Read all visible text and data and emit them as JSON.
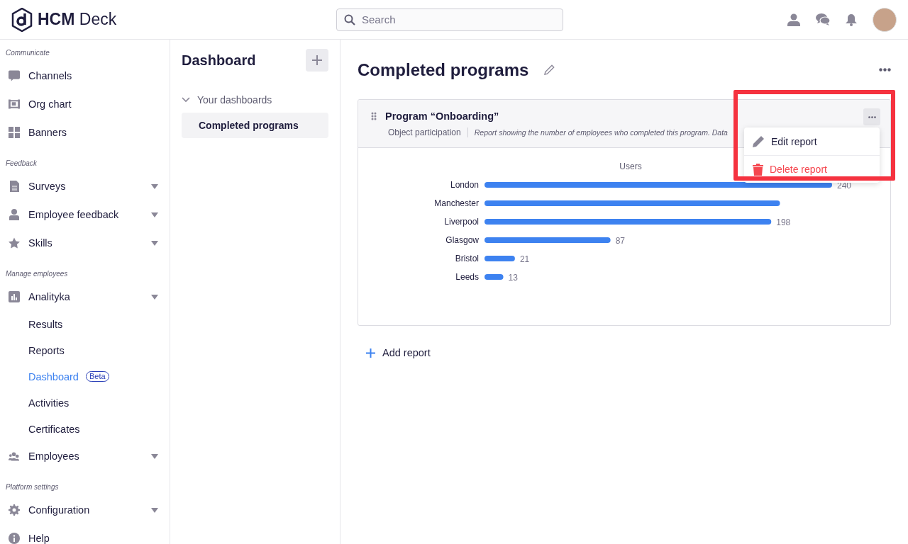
{
  "topbar": {
    "logo": "**HCM** Deck",
    "search": {
      "placeholder": "Search"
    }
  },
  "sidebar": {
    "sections": [
      {
        "title": "Communicate",
        "items": [
          {
            "label": "Channels",
            "kind": "link"
          },
          {
            "label": "Org chart",
            "kind": "link"
          },
          {
            "label": "Banners",
            "kind": "link"
          }
        ]
      },
      {
        "title": "Feedback",
        "items": [
          {
            "label": "Surveys",
            "kind": "group"
          },
          {
            "label": "Employee feedback",
            "kind": "group"
          },
          {
            "label": "Skills",
            "kind": "group"
          }
        ]
      },
      {
        "title": "Manage employees",
        "items": [
          {
            "label": "Analityka",
            "kind": "group",
            "children": [
              {
                "label": "Results",
                "selected": false
              },
              {
                "label": "Reports",
                "selected": false
              },
              {
                "label": "Dashboard",
                "selected": true,
                "badge": "Beta"
              },
              {
                "label": "Activities",
                "selected": false
              },
              {
                "label": "Certificates",
                "selected": false
              }
            ]
          },
          {
            "label": "Employees",
            "kind": "group"
          }
        ]
      },
      {
        "title": "Platform settings",
        "items": [
          {
            "label": "Configuration",
            "kind": "group"
          },
          {
            "label": "Help",
            "kind": "link"
          }
        ]
      }
    ]
  },
  "dashboards_panel": {
    "title": "Dashboard",
    "tree": [
      {
        "label": "Your dashboards",
        "expanded": true,
        "children": [
          {
            "label": "Completed programs",
            "selected": true
          }
        ]
      }
    ]
  },
  "main": {
    "title": "Completed programs",
    "report": {
      "title": "Program “Onboarding”",
      "type": "Object participation",
      "description": "Report showing the number of employees who completed this program. Data",
      "chart_data": {
        "type": "bar",
        "orientation": "horizontal",
        "title": "Users",
        "categories": [
          "London",
          "Manchester",
          "Liverpool",
          "Glasgow",
          "Bristol",
          "Leeds"
        ],
        "values": [
          240,
          204,
          198,
          87,
          21,
          13
        ],
        "value_labels": [
          "240",
          null,
          "198",
          "87",
          "21",
          "13"
        ]
      }
    },
    "menu": [
      {
        "label": "Edit report",
        "kind": "edit"
      },
      {
        "label": "Delete report",
        "kind": "delete"
      }
    ],
    "add_report": "Add report"
  }
}
